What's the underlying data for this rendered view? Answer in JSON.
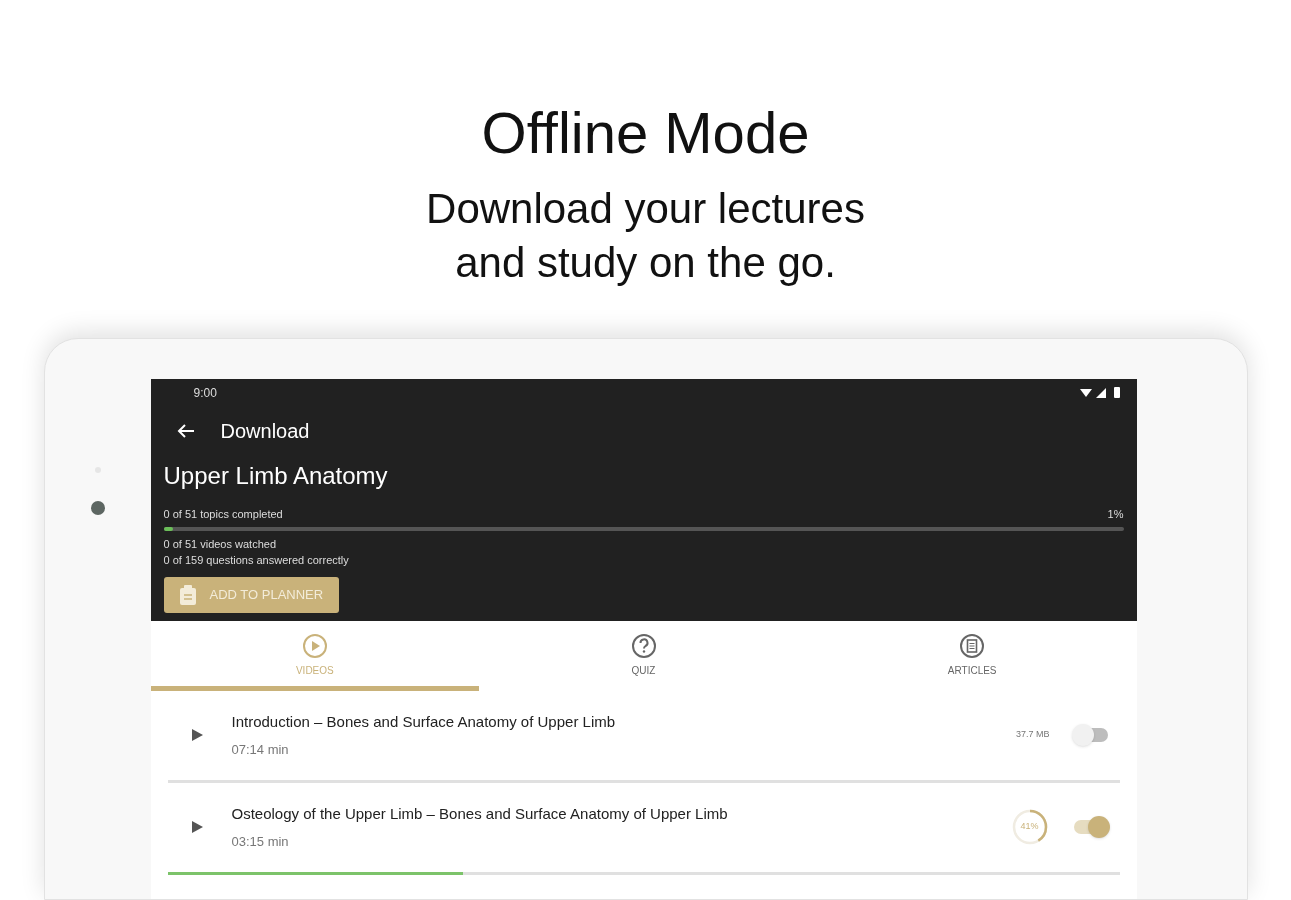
{
  "headline": "Offline Mode",
  "subheadline_lines": [
    "Download your lectures",
    "and study on the go."
  ],
  "status_bar": {
    "time": "9:00"
  },
  "toolbar": {
    "title": "Download"
  },
  "course": {
    "title": "Upper Limb Anatomy",
    "topics_text": "0 of 51 topics completed",
    "level": 0.01,
    "percent": "1%",
    "videos_text": "0 of 51 videos watched",
    "questions_text": "0 of 159 questions answered correctly",
    "button": "ADD TO PLANNER"
  },
  "tabs": [
    {
      "kind": "video",
      "label": "VIDEOS",
      "selected": true
    },
    {
      "kind": "quiz",
      "label": "QUIZ",
      "selected": false
    },
    {
      "kind": "article",
      "label": "ARTICLES",
      "selected": false
    }
  ],
  "videos": [
    {
      "kind": "size",
      "title": "Introduction – Bones and Surface Anatomy of Upper Limb",
      "duration": "07:14 min",
      "size": "37.7 MB",
      "download_on": false
    },
    {
      "kind": "progress",
      "title": "Osteology of the Upper Limb – Bones and Surface Anatomy of Upper Limb",
      "duration": "03:15 min",
      "download": {
        "reading": "41%",
        "level": 0.41
      },
      "download_on": true,
      "watched": {
        "level": 0.31
      }
    }
  ]
}
